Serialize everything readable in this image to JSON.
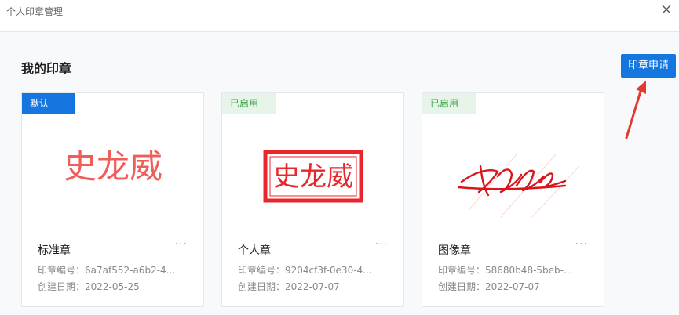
{
  "window": {
    "title": "个人印章管理"
  },
  "header": {
    "title": "我的印章",
    "apply_button": "印章申请"
  },
  "cards": [
    {
      "badge": "默认",
      "stamp_text": "史龙威",
      "name": "标准章",
      "more": "···",
      "id_label": "印章编号：",
      "id_value": "6a7af552-a6b2-4...",
      "date_label": "创建日期：",
      "date_value": "2022-05-25"
    },
    {
      "badge": "已启用",
      "stamp_text": "史龙威",
      "name": "个人章",
      "more": "···",
      "id_label": "印章编号：",
      "id_value": "9204cf3f-0e30-4...",
      "date_label": "创建日期：",
      "date_value": "2022-07-07"
    },
    {
      "badge": "已启用",
      "name": "图像章",
      "more": "···",
      "id_label": "印章编号：",
      "id_value": "58680b48-5beb-...",
      "date_label": "创建日期：",
      "date_value": "2022-07-07"
    }
  ],
  "colors": {
    "accent": "#1676e0",
    "stamp_red": "#e8262b",
    "enabled_green": "#37a244"
  },
  "icons": {
    "close": "close-icon",
    "more": "more-icon",
    "arrow": "arrow-annotation"
  }
}
